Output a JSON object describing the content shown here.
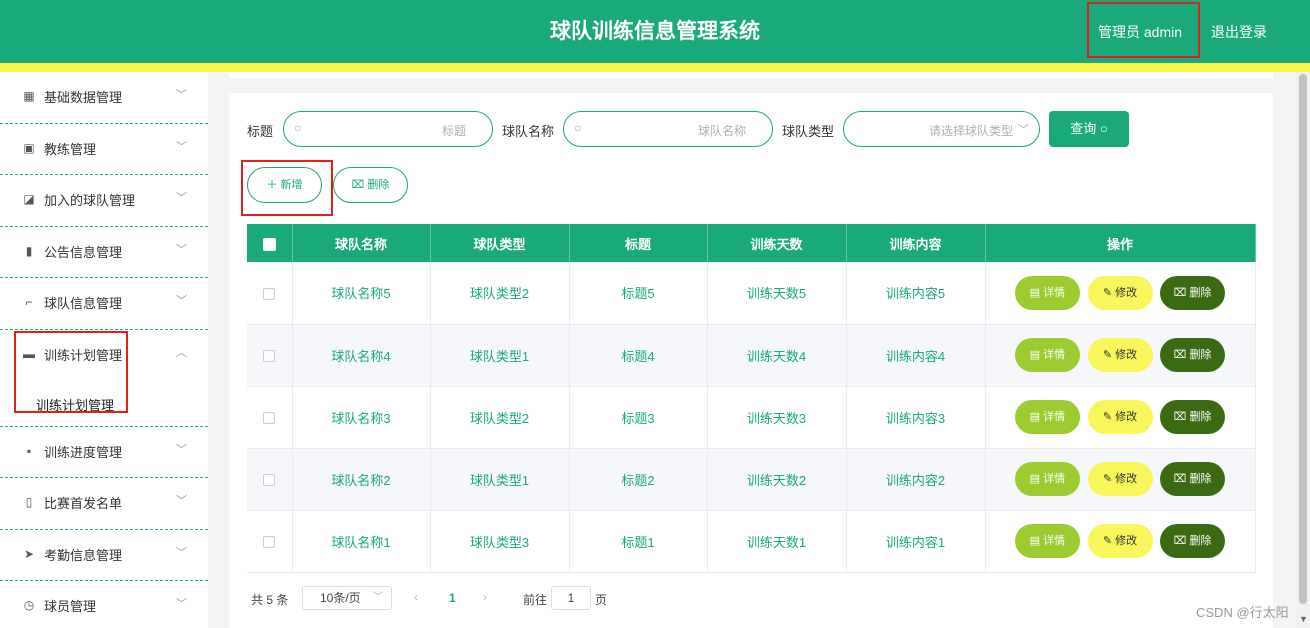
{
  "header": {
    "title": "球队训练信息管理系统",
    "user": "管理员 admin",
    "logout": "退出登录"
  },
  "sidebar": {
    "items": [
      {
        "label": "基础数据管理",
        "icon": "grid-icon"
      },
      {
        "label": "教练管理",
        "icon": "clipboard-icon"
      },
      {
        "label": "加入的球队管理",
        "icon": "chart-icon"
      },
      {
        "label": "公告信息管理",
        "icon": "notebook-icon"
      },
      {
        "label": "球队信息管理",
        "icon": "crop-icon"
      },
      {
        "label": "训练计划管理",
        "icon": "briefcase-icon",
        "open": true,
        "children": [
          "训练计划管理"
        ]
      },
      {
        "label": "训练进度管理",
        "icon": "menu-grid-icon"
      },
      {
        "label": "比赛首发名单",
        "icon": "document-icon"
      },
      {
        "label": "考勤信息管理",
        "icon": "send-icon"
      },
      {
        "label": "球员管理",
        "icon": "clock-icon"
      }
    ]
  },
  "search": {
    "label_title": "标题",
    "placeholder_title": "标题",
    "label_team": "球队名称",
    "placeholder_team": "球队名称",
    "label_type": "球队类型",
    "placeholder_type": "请选择球队类型",
    "query": "查询"
  },
  "actions": {
    "add": "新增",
    "delete": "删除"
  },
  "table": {
    "headers": [
      "球队名称",
      "球队类型",
      "标题",
      "训练天数",
      "训练内容",
      "操作"
    ],
    "rows": [
      [
        "球队名称5",
        "球队类型2",
        "标题5",
        "训练天数5",
        "训练内容5"
      ],
      [
        "球队名称4",
        "球队类型1",
        "标题4",
        "训练天数4",
        "训练内容4"
      ],
      [
        "球队名称3",
        "球队类型2",
        "标题3",
        "训练天数3",
        "训练内容3"
      ],
      [
        "球队名称2",
        "球队类型1",
        "标题2",
        "训练天数2",
        "训练内容2"
      ],
      [
        "球队名称1",
        "球队类型3",
        "标题1",
        "训练天数1",
        "训练内容1"
      ]
    ],
    "row_actions": {
      "detail": "详情",
      "edit": "修改",
      "delete": "删除"
    }
  },
  "pager": {
    "total": "共 5 条",
    "page_size": "10条/页",
    "current": "1",
    "goto": "前往",
    "goto_value": "1",
    "page_unit": "页"
  },
  "watermark": "CSDN @行太阳",
  "colors": {
    "primary": "#1aa97a",
    "accent": "#f7f54a",
    "detail": "#9ccc2f",
    "edit": "#f8f65a",
    "delete": "#3a6b12"
  }
}
